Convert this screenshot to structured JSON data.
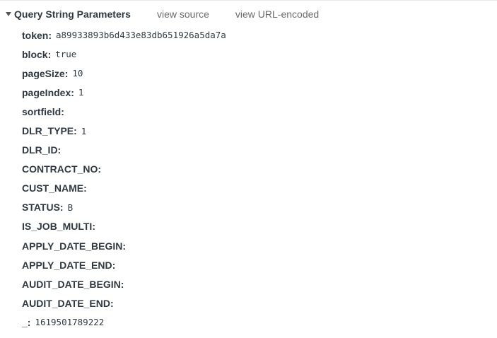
{
  "section": {
    "title": "Query String Parameters",
    "view_source": "view source",
    "view_url_encoded": "view URL-encoded"
  },
  "params": [
    {
      "key": "token:",
      "value": "a89933893b6d433e83db651926a5da7a"
    },
    {
      "key": "block:",
      "value": "true"
    },
    {
      "key": "pageSize:",
      "value": "10"
    },
    {
      "key": "pageIndex:",
      "value": "1"
    },
    {
      "key": "sortfield:",
      "value": ""
    },
    {
      "key": "DLR_TYPE:",
      "value": "1"
    },
    {
      "key": "DLR_ID:",
      "value": ""
    },
    {
      "key": "CONTRACT_NO:",
      "value": ""
    },
    {
      "key": "CUST_NAME:",
      "value": ""
    },
    {
      "key": "STATUS:",
      "value": "B"
    },
    {
      "key": "IS_JOB_MULTI:",
      "value": ""
    },
    {
      "key": "APPLY_DATE_BEGIN:",
      "value": ""
    },
    {
      "key": "APPLY_DATE_END:",
      "value": ""
    },
    {
      "key": "AUDIT_DATE_BEGIN:",
      "value": ""
    },
    {
      "key": "AUDIT_DATE_END:",
      "value": ""
    },
    {
      "key": "_:",
      "value": "1619501789222"
    }
  ]
}
